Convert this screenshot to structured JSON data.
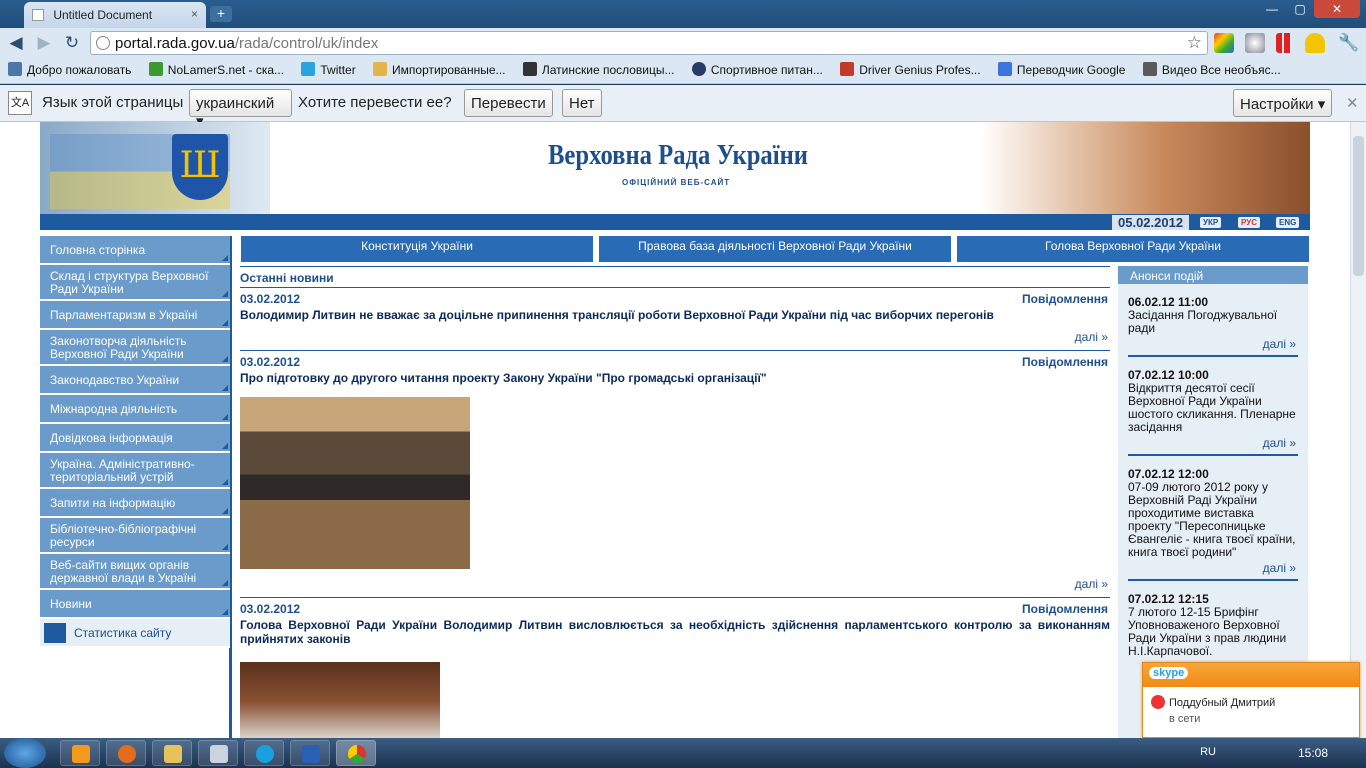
{
  "browser": {
    "tab_title": "Untitled Document",
    "tab_close": "×",
    "new_tab": "+",
    "window_controls": [
      "—",
      "▢",
      "✕"
    ],
    "url_host": "portal.rada.gov.ua",
    "url_path": "/rada/control/uk/index"
  },
  "bookmarks": [
    {
      "label": "Добро пожаловать",
      "icon": "vk-icon",
      "color": "#4a76a8"
    },
    {
      "label": "NoLamerS.net - ска...",
      "icon": "checkmark-icon",
      "color": "#3a9a2f"
    },
    {
      "label": "Twitter",
      "icon": "bird-icon",
      "color": "#2aa3e0"
    },
    {
      "label": "Импортированные...",
      "icon": "folder-icon",
      "color": "#e3b44a"
    },
    {
      "label": "Латинские пословицы...",
      "icon": "quote-icon",
      "color": "#333333"
    },
    {
      "label": "Спортивное питан...",
      "icon": "globe-icon",
      "color": "#2a3a6a"
    },
    {
      "label": "Driver Genius Profes...",
      "icon": "gear-icon",
      "color": "#c23b2a"
    },
    {
      "label": "Переводчик Google",
      "icon": "translate-icon",
      "color": "#3d74d9"
    },
    {
      "label": "Видео Все необъяс...",
      "icon": "video-icon",
      "color": "#5a5a5a"
    }
  ],
  "translate_bar": {
    "prompt": "Язык этой страницы",
    "language": "украинский",
    "question": "Хотите перевести ее?",
    "translate_btn": "Перевести",
    "no_btn": "Нет",
    "settings_btn": "Настройки",
    "close": "✕"
  },
  "header": {
    "title": "Верховна Рада України",
    "subtitle": "ОФІЦІЙНИЙ ВЕБ-САЙТ",
    "date": "05.02.2012",
    "langs": [
      "УКР",
      "РУС",
      "ENG"
    ],
    "trident": "Ш"
  },
  "sidebar": [
    "Головна сторінка",
    "Склад і структура Верховної Ради України",
    "Парламентаризм в Україні",
    "Законотворча діяльність Верховної Ради України",
    "Законодавство України",
    "Міжнародна діяльність",
    "Довідкова інформація",
    "Україна. Адміністративно-територіальний устрій",
    "Запити на інформацію",
    "Бібліотечно-бібліографічні ресурси",
    "Веб-сайти вищих органів державної влади в Україні",
    "Новини",
    "Статистика сайту"
  ],
  "top_tabs": [
    "Конституція України",
    "Правова база діяльності Верховної Ради України",
    "Голова Верховної Ради України"
  ],
  "news": {
    "heading": "Останні новини",
    "items": [
      {
        "date": "03.02.2012",
        "category": "Повідомлення",
        "title": "Володимир Литвин не вважає за доцільне припинення трансляції роботи Верховної Ради України під час виборчих перегонів",
        "more": "далі »"
      },
      {
        "date": "03.02.2012",
        "category": "Повідомлення",
        "title": "Про підготовку до другого читання проекту Закону України \"Про громадські організації\"",
        "more": "далі »"
      },
      {
        "date": "03.02.2012",
        "category": "Повідомлення",
        "title": "Голова Верховної Ради України Володимир Литвин висловлюється за необхідність здійснення парламентського контролю за виконанням прийнятих законів"
      }
    ]
  },
  "announcements": {
    "heading": "Анонси подій",
    "items": [
      {
        "time": "06.02.12 11:00",
        "text": "Засідання Погоджувальної ради",
        "more": "далі »"
      },
      {
        "time": "07.02.12 10:00",
        "text": "Відкриття десятої сесії Верховної Ради України шостого скликання. Пленарне засідання",
        "more": "далі »"
      },
      {
        "time": "07.02.12 12:00",
        "text": "07-09 лютого 2012 року у Верховній Раді України проходитиме виставка проекту \"Пересопницьке Євангеліє - книга твоєї країни, книга твоєї родини\"",
        "more": "далі »"
      },
      {
        "time": "07.02.12 12:15",
        "text": "7 лютого 12-15 Брифінг Уповноваженого Верховної Ради України з прав людини Н.І.Карпачової.",
        "more": ""
      }
    ]
  },
  "skype": {
    "brand": "skype",
    "contact": "Поддубный Дмитрий",
    "status": "в сети"
  },
  "taskbar": {
    "lang": "RU",
    "clock": "15:08"
  }
}
